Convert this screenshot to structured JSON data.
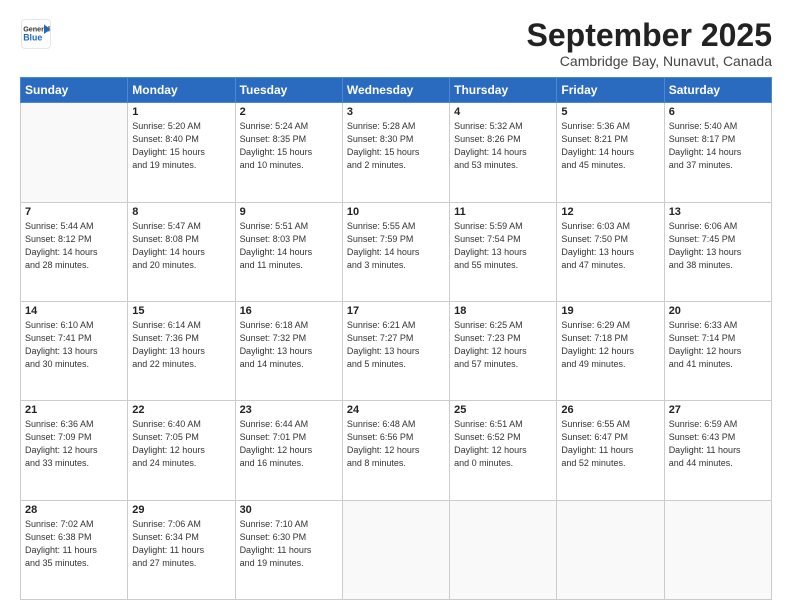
{
  "logo": {
    "general": "General",
    "blue": "Blue"
  },
  "title": "September 2025",
  "location": "Cambridge Bay, Nunavut, Canada",
  "weekdays": [
    "Sunday",
    "Monday",
    "Tuesday",
    "Wednesday",
    "Thursday",
    "Friday",
    "Saturday"
  ],
  "weeks": [
    [
      {
        "day": "",
        "info": ""
      },
      {
        "day": "1",
        "info": "Sunrise: 5:20 AM\nSunset: 8:40 PM\nDaylight: 15 hours\nand 19 minutes."
      },
      {
        "day": "2",
        "info": "Sunrise: 5:24 AM\nSunset: 8:35 PM\nDaylight: 15 hours\nand 10 minutes."
      },
      {
        "day": "3",
        "info": "Sunrise: 5:28 AM\nSunset: 8:30 PM\nDaylight: 15 hours\nand 2 minutes."
      },
      {
        "day": "4",
        "info": "Sunrise: 5:32 AM\nSunset: 8:26 PM\nDaylight: 14 hours\nand 53 minutes."
      },
      {
        "day": "5",
        "info": "Sunrise: 5:36 AM\nSunset: 8:21 PM\nDaylight: 14 hours\nand 45 minutes."
      },
      {
        "day": "6",
        "info": "Sunrise: 5:40 AM\nSunset: 8:17 PM\nDaylight: 14 hours\nand 37 minutes."
      }
    ],
    [
      {
        "day": "7",
        "info": "Sunrise: 5:44 AM\nSunset: 8:12 PM\nDaylight: 14 hours\nand 28 minutes."
      },
      {
        "day": "8",
        "info": "Sunrise: 5:47 AM\nSunset: 8:08 PM\nDaylight: 14 hours\nand 20 minutes."
      },
      {
        "day": "9",
        "info": "Sunrise: 5:51 AM\nSunset: 8:03 PM\nDaylight: 14 hours\nand 11 minutes."
      },
      {
        "day": "10",
        "info": "Sunrise: 5:55 AM\nSunset: 7:59 PM\nDaylight: 14 hours\nand 3 minutes."
      },
      {
        "day": "11",
        "info": "Sunrise: 5:59 AM\nSunset: 7:54 PM\nDaylight: 13 hours\nand 55 minutes."
      },
      {
        "day": "12",
        "info": "Sunrise: 6:03 AM\nSunset: 7:50 PM\nDaylight: 13 hours\nand 47 minutes."
      },
      {
        "day": "13",
        "info": "Sunrise: 6:06 AM\nSunset: 7:45 PM\nDaylight: 13 hours\nand 38 minutes."
      }
    ],
    [
      {
        "day": "14",
        "info": "Sunrise: 6:10 AM\nSunset: 7:41 PM\nDaylight: 13 hours\nand 30 minutes."
      },
      {
        "day": "15",
        "info": "Sunrise: 6:14 AM\nSunset: 7:36 PM\nDaylight: 13 hours\nand 22 minutes."
      },
      {
        "day": "16",
        "info": "Sunrise: 6:18 AM\nSunset: 7:32 PM\nDaylight: 13 hours\nand 14 minutes."
      },
      {
        "day": "17",
        "info": "Sunrise: 6:21 AM\nSunset: 7:27 PM\nDaylight: 13 hours\nand 5 minutes."
      },
      {
        "day": "18",
        "info": "Sunrise: 6:25 AM\nSunset: 7:23 PM\nDaylight: 12 hours\nand 57 minutes."
      },
      {
        "day": "19",
        "info": "Sunrise: 6:29 AM\nSunset: 7:18 PM\nDaylight: 12 hours\nand 49 minutes."
      },
      {
        "day": "20",
        "info": "Sunrise: 6:33 AM\nSunset: 7:14 PM\nDaylight: 12 hours\nand 41 minutes."
      }
    ],
    [
      {
        "day": "21",
        "info": "Sunrise: 6:36 AM\nSunset: 7:09 PM\nDaylight: 12 hours\nand 33 minutes."
      },
      {
        "day": "22",
        "info": "Sunrise: 6:40 AM\nSunset: 7:05 PM\nDaylight: 12 hours\nand 24 minutes."
      },
      {
        "day": "23",
        "info": "Sunrise: 6:44 AM\nSunset: 7:01 PM\nDaylight: 12 hours\nand 16 minutes."
      },
      {
        "day": "24",
        "info": "Sunrise: 6:48 AM\nSunset: 6:56 PM\nDaylight: 12 hours\nand 8 minutes."
      },
      {
        "day": "25",
        "info": "Sunrise: 6:51 AM\nSunset: 6:52 PM\nDaylight: 12 hours\nand 0 minutes."
      },
      {
        "day": "26",
        "info": "Sunrise: 6:55 AM\nSunset: 6:47 PM\nDaylight: 11 hours\nand 52 minutes."
      },
      {
        "day": "27",
        "info": "Sunrise: 6:59 AM\nSunset: 6:43 PM\nDaylight: 11 hours\nand 44 minutes."
      }
    ],
    [
      {
        "day": "28",
        "info": "Sunrise: 7:02 AM\nSunset: 6:38 PM\nDaylight: 11 hours\nand 35 minutes."
      },
      {
        "day": "29",
        "info": "Sunrise: 7:06 AM\nSunset: 6:34 PM\nDaylight: 11 hours\nand 27 minutes."
      },
      {
        "day": "30",
        "info": "Sunrise: 7:10 AM\nSunset: 6:30 PM\nDaylight: 11 hours\nand 19 minutes."
      },
      {
        "day": "",
        "info": ""
      },
      {
        "day": "",
        "info": ""
      },
      {
        "day": "",
        "info": ""
      },
      {
        "day": "",
        "info": ""
      }
    ]
  ]
}
